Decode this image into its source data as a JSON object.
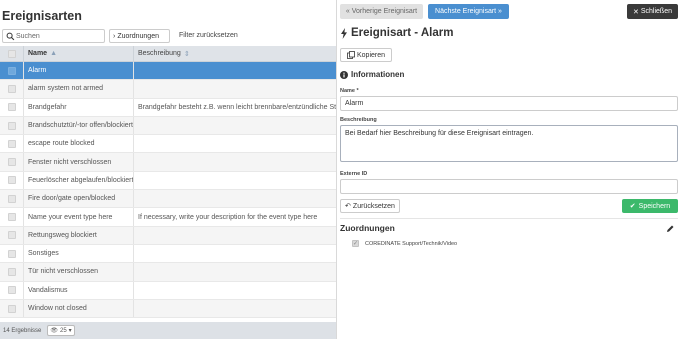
{
  "list": {
    "title": "Ereignisarten",
    "search_placeholder": "Suchen",
    "assign_button": "Zuordnungen",
    "filter_reset": "Filter zurücksetzen",
    "columns": {
      "name": "Name",
      "description": "Beschreibung"
    },
    "rows": [
      {
        "name": "Alarm",
        "description": ""
      },
      {
        "name": "alarm system not armed",
        "description": ""
      },
      {
        "name": "Brandgefahr",
        "description": "Brandgefahr besteht z.B. wenn leicht brennbare/entzündliche Stoffe in"
      },
      {
        "name": "Brandschutztür/-tor offen/blockiert",
        "description": ""
      },
      {
        "name": "escape route blocked",
        "description": ""
      },
      {
        "name": "Fenster nicht verschlossen",
        "description": ""
      },
      {
        "name": "Feuerlöscher abgelaufen/blockiert",
        "description": ""
      },
      {
        "name": "Fire door/gate open/blocked",
        "description": ""
      },
      {
        "name": "Name your event type here",
        "description": "If necessary, write your description for the event type here"
      },
      {
        "name": "Rettungsweg blockiert",
        "description": ""
      },
      {
        "name": "Sonstiges",
        "description": ""
      },
      {
        "name": "Tür nicht verschlossen",
        "description": ""
      },
      {
        "name": "Vandalismus",
        "description": ""
      },
      {
        "name": "Window not closed",
        "description": ""
      }
    ],
    "selected_index": 0,
    "footer": {
      "count": "14 Ergebnisse",
      "per_page": "25"
    }
  },
  "detail": {
    "prev_button": "« Vorherige Ereignisart",
    "next_button": "Nächste Ereignisart »",
    "close_button": "Schließen",
    "title": "Ereignisart - Alarm",
    "copy_button": "Kopieren",
    "info_section": "Informationen",
    "name_label": "Name *",
    "name_value": "Alarm",
    "description_label": "Beschreibung",
    "description_value": "Bei Bedarf hier Beschreibung für diese Ereignisart eintragen.",
    "external_id_label": "Externe ID",
    "external_id_value": "",
    "reset_button": "Zurücksetzen",
    "save_button": "Speichern",
    "assign_section": "Zuordnungen",
    "assign_items": [
      {
        "label": "COREDINATE Support/Technik/Video",
        "checked": true
      }
    ]
  },
  "colors": {
    "accent": "#4a8fd0",
    "save": "#3cb96b",
    "close": "#3a3a3a"
  }
}
